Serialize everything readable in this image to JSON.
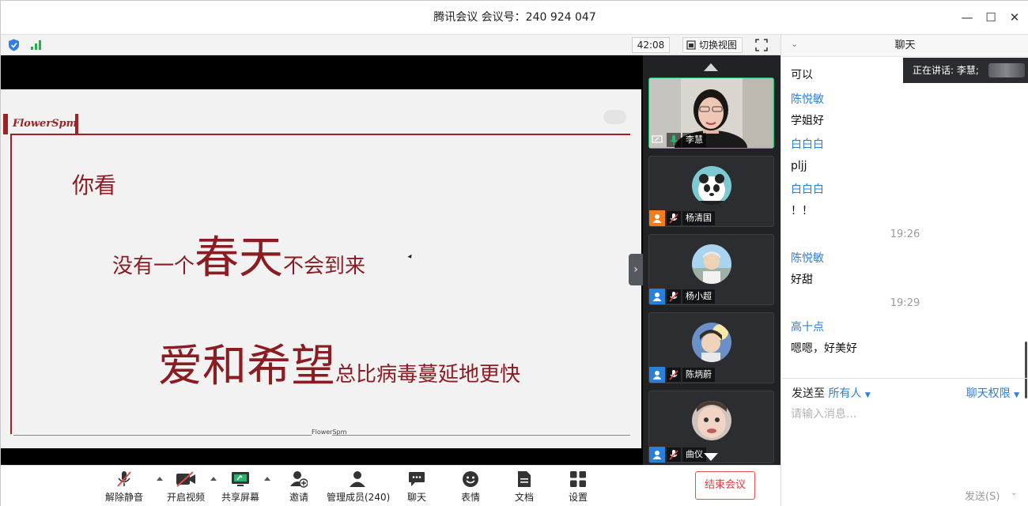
{
  "window": {
    "title": "腾讯会议 会议号：240 924 047",
    "controls": [
      "minimize-icon",
      "maximize-icon",
      "close-icon"
    ]
  },
  "meeting_bar": {
    "timer": "42:08",
    "switch_view_label": "切换视图"
  },
  "slide": {
    "logo": "FlowerSpm",
    "line1": "你看",
    "line2_pre": "没有一个",
    "line2_big": "春天",
    "line2_post": "不会到来",
    "line3_big": "爱和希望",
    "line3_post": "总比病毒蔓延地更快",
    "footer_mark": "FlowerSpm",
    "accent": "#8a1c22"
  },
  "participants": [
    {
      "name": "李慧",
      "video": true,
      "active": true
    },
    {
      "name": "杨清国",
      "video": false,
      "role_color": "#f07d1f"
    },
    {
      "name": "杨小超",
      "video": false,
      "role_color": "#2a7fd8"
    },
    {
      "name": "陈炳蔚",
      "video": false,
      "role_color": "#2a7fd8"
    },
    {
      "name": "曲仪",
      "video": false,
      "role_color": "#2a7fd8"
    }
  ],
  "speaking": {
    "text": "正在讲话: 李慧;"
  },
  "chat": {
    "title": "聊天",
    "messages": [
      {
        "kind": "body",
        "text": "可以"
      },
      {
        "kind": "sender",
        "text": "陈悦敏"
      },
      {
        "kind": "body",
        "text": "学姐好"
      },
      {
        "kind": "sender",
        "text": "白白白"
      },
      {
        "kind": "body",
        "text": "pljj"
      },
      {
        "kind": "sender",
        "text": "白白白"
      },
      {
        "kind": "body",
        "text": "！！"
      },
      {
        "kind": "time",
        "text": "19:26"
      },
      {
        "kind": "sender",
        "text": "陈悦敏"
      },
      {
        "kind": "body",
        "text": "好甜"
      },
      {
        "kind": "time",
        "text": "19:29"
      },
      {
        "kind": "sender",
        "text": "高十点"
      },
      {
        "kind": "body",
        "text": "嗯嗯，好美好"
      }
    ],
    "send_to_label": "发送至",
    "send_to_value": "所有人",
    "permission_label": "聊天权限",
    "input_placeholder": "请输入消息...",
    "send_button": "发送(S)"
  },
  "toolbar": {
    "items": [
      {
        "id": "unmute",
        "label": "解除静音",
        "icon": "mic-muted-icon"
      },
      {
        "id": "video",
        "label": "开启视频",
        "icon": "video-off-icon"
      },
      {
        "id": "share",
        "label": "共享屏幕",
        "icon": "share-screen-icon"
      },
      {
        "id": "invite",
        "label": "邀请",
        "icon": "invite-icon"
      },
      {
        "id": "members",
        "label": "管理成员(240)",
        "icon": "members-icon"
      },
      {
        "id": "chat",
        "label": "聊天",
        "icon": "chat-icon"
      },
      {
        "id": "emoji",
        "label": "表情",
        "icon": "emoji-icon"
      },
      {
        "id": "docs",
        "label": "文档",
        "icon": "document-icon"
      },
      {
        "id": "settings",
        "label": "设置",
        "icon": "settings-icon"
      }
    ],
    "end_label": "结束会议",
    "end_color": "#e03c3c"
  }
}
